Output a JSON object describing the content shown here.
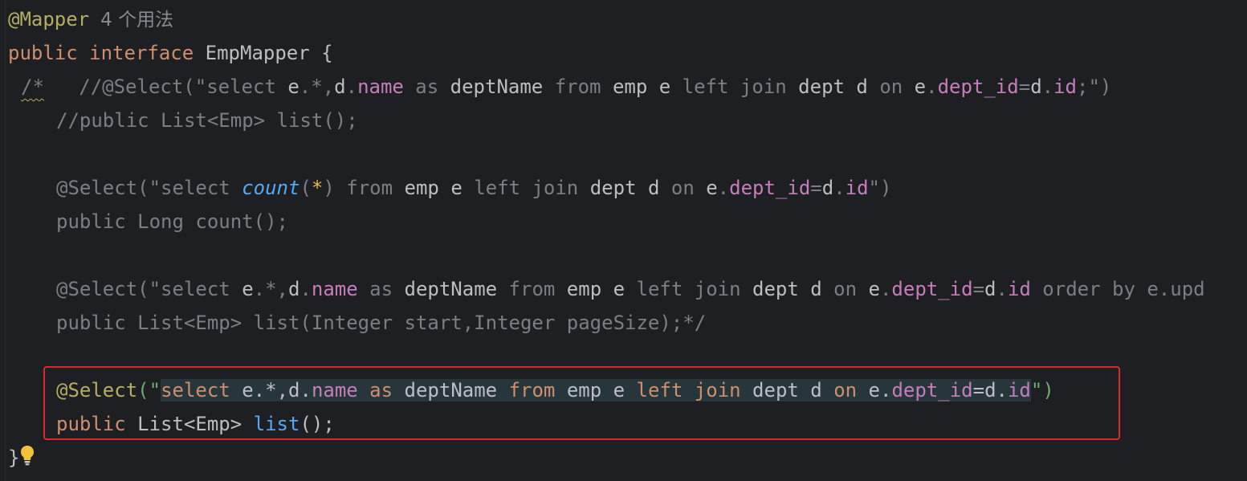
{
  "editor": {
    "usage_hint": "4 个用法",
    "lines": {
      "l1_annotation": "@Mapper",
      "l2_public": "public",
      "l2_interface": "interface",
      "l2_name": "EmpMapper",
      "l2_brace": "{",
      "l3_comment_open": "/*",
      "l3_text_a": "   //@Select(\"select ",
      "l3_e1": "e",
      "l3_t2": ".*,",
      "l3_d1": "d",
      "l3_dot1": ".",
      "l3_name": "name",
      "l3_as": " as ",
      "l3_deptName": "deptName",
      "l3_from": " from ",
      "l3_emp": "emp",
      "l3_sp1": " ",
      "l3_e2": "e",
      "l3_leftjoin": " left join ",
      "l3_dept": "dept",
      "l3_sp2": " ",
      "l3_d2": "d",
      "l3_on": " on ",
      "l3_e3": "e",
      "l3_dot2": ".",
      "l3_deptid": "dept_id",
      "l3_eq": "=",
      "l3_d3": "d",
      "l3_dot3": ".",
      "l3_id": "id",
      "l3_end": ";\")",
      "l4": "//public List<Emp> list();",
      "l6_a": "@Select(\"select ",
      "l6_count": "count",
      "l6_lp": "(",
      "l6_star": "*",
      "l6_rp": ")",
      "l6_from": " from ",
      "l6_emp": "emp",
      "l6_sp1": " ",
      "l6_e": "e",
      "l6_leftjoin": " left join ",
      "l6_dept": "dept",
      "l6_sp2": " ",
      "l6_d": "d",
      "l6_on": " on ",
      "l6_e2": "e",
      "l6_dot1": ".",
      "l6_deptid": "dept_id",
      "l6_eq": "=",
      "l6_d2": "d",
      "l6_dot2": ".",
      "l6_id": "id",
      "l6_end": "\")",
      "l7": "public Long count();",
      "l9_a": "@Select(\"select ",
      "l9_e": "e",
      "l9_t2": ".*,",
      "l9_d": "d",
      "l9_dot1": ".",
      "l9_name": "name",
      "l9_as": " as ",
      "l9_deptName": "deptName",
      "l9_from": " from ",
      "l9_emp": "emp",
      "l9_sp1": " ",
      "l9_e2": "e",
      "l9_leftjoin": " left join ",
      "l9_dept": "dept",
      "l9_sp2": " ",
      "l9_d2": "d",
      "l9_on": " on ",
      "l9_e3": "e",
      "l9_dot2": ".",
      "l9_deptid": "dept_id",
      "l9_eq": "=",
      "l9_d3": "d",
      "l9_dot3": ".",
      "l9_id": "id",
      "l9_orderby": " order by ",
      "l9_tail": "e.upd",
      "l10": "public List<Emp> list(Integer start,Integer pageSize);*/",
      "l12_annot": "@Select",
      "l12_lp": "(\"",
      "l12_select": "select",
      "l12_sp0": " ",
      "l12_e": "e",
      "l12_t2": ".*,",
      "l12_d": "d",
      "l12_dot1": ".",
      "l12_name": "name",
      "l12_as": " as ",
      "l12_deptName": "deptName",
      "l12_from": " from ",
      "l12_emp": "emp",
      "l12_sp1": " ",
      "l12_e2": "e",
      "l12_left": " left ",
      "l12_join": "join",
      "l12_sp2": " ",
      "l12_dept": "dept",
      "l12_sp3": " ",
      "l12_d2": "d",
      "l12_on": " on ",
      "l12_e3": "e",
      "l12_dot2": ".",
      "l12_deptid": "dept_id",
      "l12_eq": "=",
      "l12_d3": "d",
      "l12_dot3": ".",
      "l12_id": "id",
      "l12_end": "\")",
      "l13_public": "public",
      "l13_type": " List<Emp> ",
      "l13_method": "list",
      "l13_end": "();",
      "l14": "}"
    }
  },
  "colors": {
    "background": "#1e1f22",
    "annotation": "#b3ae60",
    "keyword": "#cf8e6d",
    "comment": "#7a7e85",
    "string": "#6aab73",
    "field": "#c77dbb",
    "method": "#56a8f5",
    "highlight_border": "#e0262a"
  }
}
